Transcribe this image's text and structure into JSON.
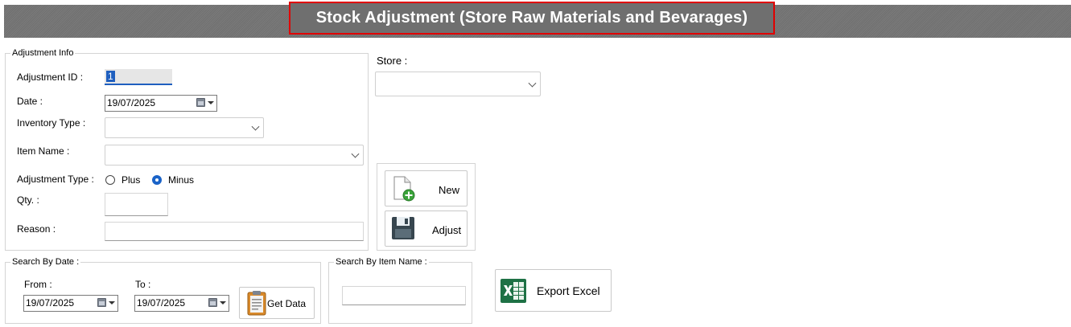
{
  "header": {
    "title": "Stock Adjustment (Store Raw Materials and Bevarages)"
  },
  "adjustment_info": {
    "legend": "Adjustment Info",
    "adjustment_id_label": "Adjustment ID :",
    "adjustment_id_value": "1",
    "date_label": "Date :",
    "date_value": "19/07/2025",
    "inventory_type_label": "Inventory Type :",
    "inventory_type_value": "",
    "item_name_label": "Item Name :",
    "item_name_value": "",
    "adjustment_type_label": "Adjustment Type :",
    "plus_label": "Plus",
    "minus_label": "Minus",
    "selected_type": "Minus",
    "qty_label": "Qty. :",
    "qty_value": "",
    "reason_label": "Reason :",
    "reason_value": ""
  },
  "store": {
    "label": "Store :",
    "value": ""
  },
  "actions": {
    "new_label": "New",
    "adjust_label": "Adjust"
  },
  "search_by_date": {
    "legend": "Search By Date :",
    "from_label": "From :",
    "from_value": "19/07/2025",
    "to_label": "To :",
    "to_value": "19/07/2025",
    "get_data_label": "Get Data"
  },
  "search_by_item": {
    "legend": "Search By Item Name :",
    "value": ""
  },
  "export": {
    "label": "Export Excel"
  },
  "colors": {
    "header_bg": "#707070",
    "title_border": "#e00000",
    "radio_selected": "#1a63c8",
    "excel_green": "#1e7145"
  },
  "icons": [
    "new-document-icon",
    "save-disk-icon",
    "clipboard-icon",
    "excel-icon",
    "calendar-icon",
    "chevron-down-icon"
  ]
}
